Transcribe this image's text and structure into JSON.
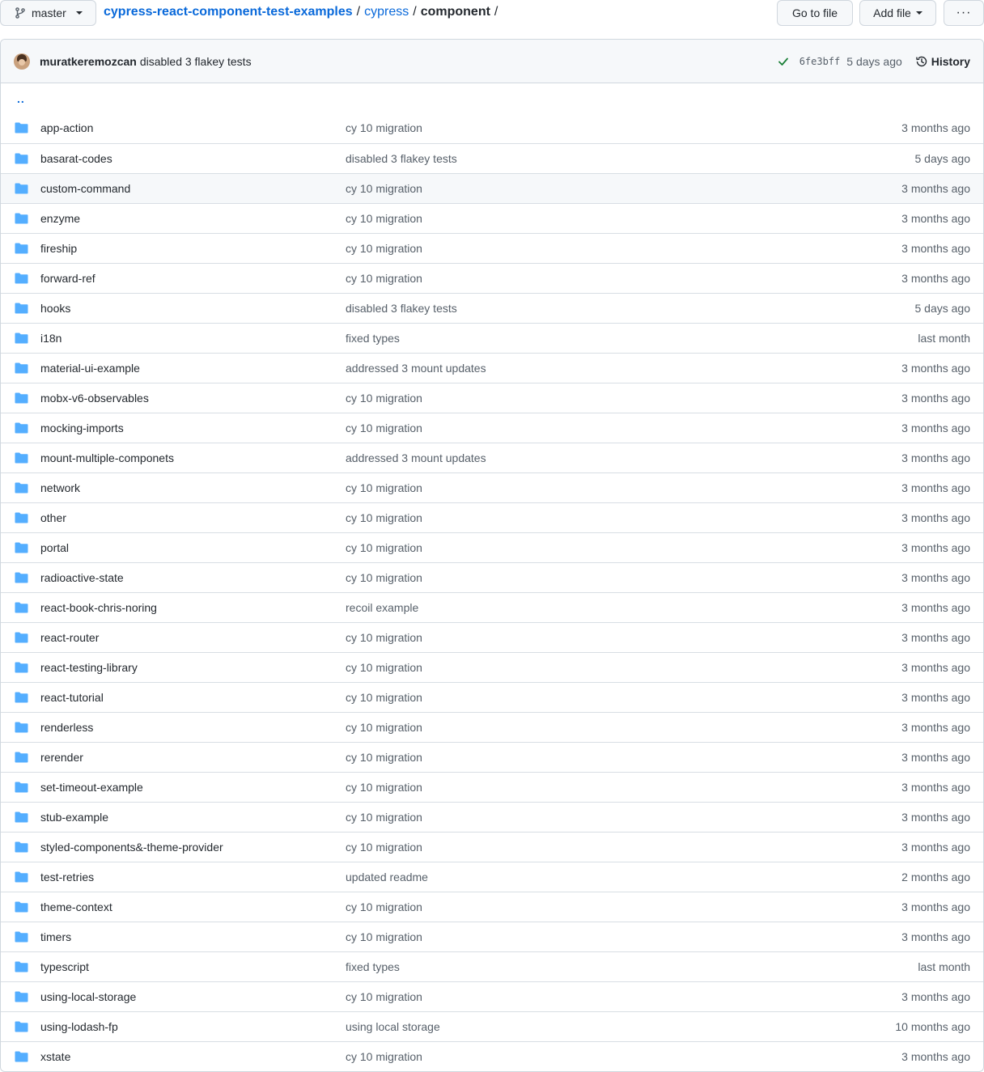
{
  "branch": {
    "label": "master",
    "icon": "git-branch-icon"
  },
  "breadcrumb": {
    "repo": "cypress-react-component-test-examples",
    "sep1": "/",
    "dir": "cypress",
    "sep2": "/",
    "current": "component",
    "sep3": "/"
  },
  "toolbar": {
    "goto_label": "Go to file",
    "addfile_label": "Add file",
    "more_label": "···"
  },
  "commit": {
    "author": "muratkeremozcan",
    "message": "disabled 3 flakey tests",
    "sha": "6fe3bff",
    "age": "5 days ago",
    "history_label": "History",
    "status_icon": "check-icon"
  },
  "parent_dir": "..",
  "files": [
    {
      "name": "app-action",
      "message": "cy 10 migration",
      "age": "3 months ago"
    },
    {
      "name": "basarat-codes",
      "message": "disabled 3 flakey tests",
      "age": "5 days ago"
    },
    {
      "name": "custom-command",
      "message": "cy 10 migration",
      "age": "3 months ago"
    },
    {
      "name": "enzyme",
      "message": "cy 10 migration",
      "age": "3 months ago"
    },
    {
      "name": "fireship",
      "message": "cy 10 migration",
      "age": "3 months ago"
    },
    {
      "name": "forward-ref",
      "message": "cy 10 migration",
      "age": "3 months ago"
    },
    {
      "name": "hooks",
      "message": "disabled 3 flakey tests",
      "age": "5 days ago"
    },
    {
      "name": "i18n",
      "message": "fixed types",
      "age": "last month"
    },
    {
      "name": "material-ui-example",
      "message": "addressed 3 mount updates",
      "age": "3 months ago"
    },
    {
      "name": "mobx-v6-observables",
      "message": "cy 10 migration",
      "age": "3 months ago"
    },
    {
      "name": "mocking-imports",
      "message": "cy 10 migration",
      "age": "3 months ago"
    },
    {
      "name": "mount-multiple-componets",
      "message": "addressed 3 mount updates",
      "age": "3 months ago"
    },
    {
      "name": "network",
      "message": "cy 10 migration",
      "age": "3 months ago"
    },
    {
      "name": "other",
      "message": "cy 10 migration",
      "age": "3 months ago"
    },
    {
      "name": "portal",
      "message": "cy 10 migration",
      "age": "3 months ago"
    },
    {
      "name": "radioactive-state",
      "message": "cy 10 migration",
      "age": "3 months ago"
    },
    {
      "name": "react-book-chris-noring",
      "message": "recoil example",
      "age": "3 months ago"
    },
    {
      "name": "react-router",
      "message": "cy 10 migration",
      "age": "3 months ago"
    },
    {
      "name": "react-testing-library",
      "message": "cy 10 migration",
      "age": "3 months ago"
    },
    {
      "name": "react-tutorial",
      "message": "cy 10 migration",
      "age": "3 months ago"
    },
    {
      "name": "renderless",
      "message": "cy 10 migration",
      "age": "3 months ago"
    },
    {
      "name": "rerender",
      "message": "cy 10 migration",
      "age": "3 months ago"
    },
    {
      "name": "set-timeout-example",
      "message": "cy 10 migration",
      "age": "3 months ago"
    },
    {
      "name": "stub-example",
      "message": "cy 10 migration",
      "age": "3 months ago"
    },
    {
      "name": "styled-components&-theme-provider",
      "message": "cy 10 migration",
      "age": "3 months ago"
    },
    {
      "name": "test-retries",
      "message": "updated readme",
      "age": "2 months ago"
    },
    {
      "name": "theme-context",
      "message": "cy 10 migration",
      "age": "3 months ago"
    },
    {
      "name": "timers",
      "message": "cy 10 migration",
      "age": "3 months ago"
    },
    {
      "name": "typescript",
      "message": "fixed types",
      "age": "last month"
    },
    {
      "name": "using-local-storage",
      "message": "cy 10 migration",
      "age": "3 months ago"
    },
    {
      "name": "using-lodash-fp",
      "message": "using local storage",
      "age": "10 months ago"
    },
    {
      "name": "xstate",
      "message": "cy 10 migration",
      "age": "3 months ago"
    }
  ],
  "hover_row": "custom-command",
  "colors": {
    "link": "#0969da",
    "folder": "#54aeff",
    "muted": "#57606a",
    "success": "#1a7f37"
  }
}
